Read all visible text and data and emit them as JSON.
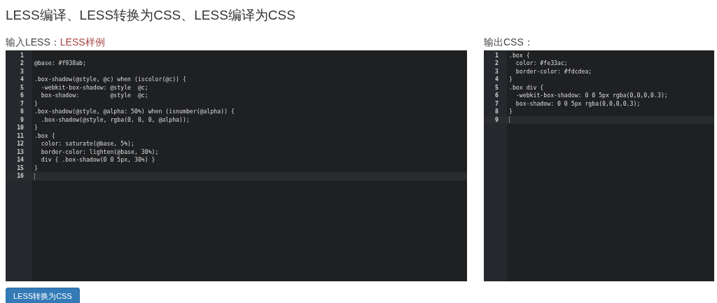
{
  "title": "LESS编译、LESS转换为CSS、LESS编译为CSS",
  "input_label": {
    "text": "输入LESS：",
    "link": "LESS样例"
  },
  "output_label": {
    "text": "输出CSS："
  },
  "input_editor": {
    "lines": [
      {
        "number": "1",
        "active": false
      },
      {
        "number": "2",
        "code": "@base: #f938ab;",
        "active": false
      },
      {
        "number": "3",
        "active": false
      },
      {
        "number": "4",
        "code": ".box-shadow(@style, @c) when (iscolor(@c)) {",
        "active": false
      },
      {
        "number": "5",
        "code": "  -webkit-box-shadow: @style  @c;",
        "active": false
      },
      {
        "number": "6",
        "code": "  box-shadow:         @style  @c;",
        "active": false
      },
      {
        "number": "7",
        "code": "}",
        "active": false
      },
      {
        "number": "8",
        "code": ".box-shadow(@style, @alpha: 50%) when (isnumber(@alpha)) {",
        "active": false
      },
      {
        "number": "9",
        "code": "  .box-shadow(@style, rgba(0, 0, 0, @alpha));",
        "active": false
      },
      {
        "number": "10",
        "code": "}",
        "active": false
      },
      {
        "number": "11",
        "code": ".box {",
        "active": false
      },
      {
        "number": "12",
        "code": "  color: saturate(@base, 5%);",
        "active": false
      },
      {
        "number": "13",
        "code": "  border-color: lighten(@base, 30%);",
        "active": false
      },
      {
        "number": "14",
        "code": "  div { .box-shadow(0 0 5px, 30%) }",
        "active": false
      },
      {
        "number": "15",
        "code": "}",
        "active": false
      },
      {
        "number": "16",
        "active": true
      }
    ]
  },
  "output_editor": {
    "lines": [
      {
        "number": "1",
        "code": ".box {",
        "active": false
      },
      {
        "number": "2",
        "code": "  color: #fe33ac;",
        "active": false
      },
      {
        "number": "3",
        "code": "  border-color: #fdcdea;",
        "active": false
      },
      {
        "number": "4",
        "code": "}",
        "active": false
      },
      {
        "number": "5",
        "code": ".box div {",
        "active": false
      },
      {
        "number": "6",
        "code": "  -webkit-box-shadow: 0 0 5px rgba(0,0,0,0.3);",
        "active": false
      },
      {
        "number": "7",
        "code": "  box-shadow: 0 0 5px rgba(0,0,0,0.3);",
        "active": false
      },
      {
        "number": "8",
        "code": "}",
        "active": false
      },
      {
        "number": "9",
        "active": true
      }
    ]
  },
  "convert_button": {
    "label": "LESS转换为CSS"
  }
}
